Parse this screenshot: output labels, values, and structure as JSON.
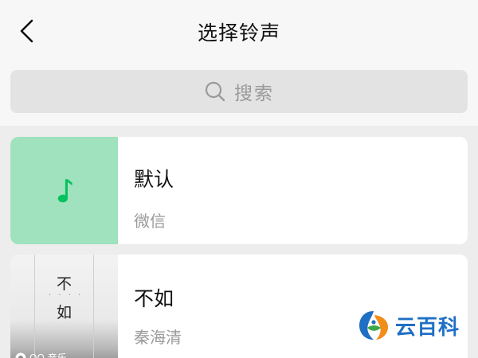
{
  "header": {
    "title": "选择铃声"
  },
  "search": {
    "placeholder": "搜索"
  },
  "ringtones": [
    {
      "name": "默认",
      "artist": "微信"
    },
    {
      "name": "不如",
      "artist": "秦海清",
      "album_char_1": "不",
      "album_char_2": "如",
      "badge": "QQ 音乐"
    }
  ],
  "watermark": {
    "text": "云百科"
  },
  "colors": {
    "accent_green": "#07c160",
    "thumb_green": "#9fe2bd",
    "background": "#ededed"
  }
}
